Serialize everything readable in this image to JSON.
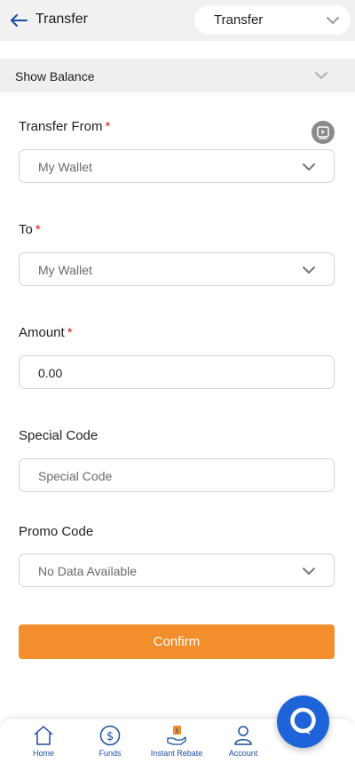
{
  "header": {
    "title": "Transfer",
    "select_value": "Transfer",
    "back_icon": "arrow-left-icon"
  },
  "balance": {
    "label": "Show Balance"
  },
  "form": {
    "transfer_from": {
      "label": "Transfer From",
      "required_mark": "*",
      "value": "My Wallet"
    },
    "to": {
      "label": "To",
      "required_mark": "*",
      "value": "My Wallet"
    },
    "amount": {
      "label": "Amount",
      "required_mark": "*",
      "value": "0.00"
    },
    "special_code": {
      "label": "Special Code",
      "placeholder": "Special Code"
    },
    "promo_code": {
      "label": "Promo Code",
      "value": "No Data Available"
    }
  },
  "confirm_label": "Confirm",
  "nav": {
    "items": [
      {
        "label": "Home",
        "icon": "home-icon"
      },
      {
        "label": "Funds",
        "icon": "dollar-coin-icon"
      },
      {
        "label": "Instant Rebate",
        "icon": "rebate-hand-icon"
      },
      {
        "label": "Account",
        "icon": "user-icon"
      }
    ]
  },
  "colors": {
    "accent": "#f28f2c",
    "nav_blue": "#1a4fa0",
    "fab": "#1f63d9",
    "required": "#d81e1e"
  }
}
